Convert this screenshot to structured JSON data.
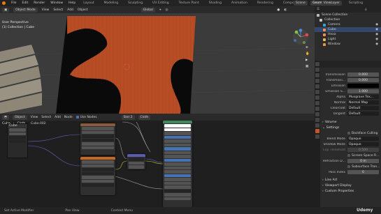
{
  "menubar": {
    "items": [
      "File",
      "Edit",
      "Render",
      "Window",
      "Help"
    ],
    "workspaces": [
      "Layout",
      "Modeling",
      "Sculpting",
      "UV Editing",
      "Texture Paint",
      "Shading",
      "Animation",
      "Rendering",
      "Compositing",
      "Geometry Nodes",
      "Scripting"
    ],
    "active_workspace": "Geometry Nodes",
    "scene": "Scene",
    "view_layer": "ViewLayer"
  },
  "viewport": {
    "mode": "Object Mode",
    "menus": [
      "View",
      "Select",
      "Add",
      "Object"
    ],
    "transform": "Global",
    "perspective_label": "User Perspective",
    "collection_label": "(1) Collection | Cube"
  },
  "outliner": {
    "title": "Scene Collection",
    "rows": [
      {
        "label": "Collection",
        "color": "#c8c8c8",
        "selected": false,
        "indent": 1
      },
      {
        "label": "Camera",
        "color": "#2fa6d8",
        "selected": false,
        "indent": 2
      },
      {
        "label": "Cube",
        "color": "#e8934d",
        "selected": true,
        "indent": 2
      },
      {
        "label": "Hexa",
        "color": "#e8934d",
        "selected": false,
        "indent": 2
      },
      {
        "label": "Light",
        "color": "#e8b84d",
        "selected": false,
        "indent": 2
      },
      {
        "label": "Window",
        "color": "#e8934d",
        "selected": false,
        "indent": 2
      }
    ]
  },
  "properties": {
    "rows": [
      {
        "label": "Transmission",
        "value": "0.000",
        "type": "num"
      },
      {
        "label": "Transmissi...",
        "value": "0.000",
        "type": "num"
      },
      {
        "label": "Emission",
        "value": "",
        "type": "color"
      },
      {
        "label": "Emission S...",
        "value": "1.000",
        "type": "num"
      },
      {
        "label": "Alpha",
        "value": "Musgrave Tex...",
        "type": "link"
      },
      {
        "label": "Normal",
        "value": "Normal Map",
        "type": "link"
      },
      {
        "label": "Clearcoat",
        "value": "Default",
        "type": "link"
      },
      {
        "label": "Tangent",
        "value": "Default",
        "type": "link"
      }
    ],
    "volume_label": "Volume",
    "settings_label": "Settings",
    "backface_label": "Backface Culling",
    "blend_mode_label": "Blend Mode",
    "blend_mode_value": "Opaque",
    "shadow_mode_label": "Shadow Mode",
    "shadow_mode_value": "Opaque",
    "clip_label": "Clip Threshold",
    "clip_value": "0.500",
    "screen_space_label": "Screen Space R...",
    "refraction_label": "Refraction D...",
    "refraction_value": "0 m",
    "subsurface_label": "Subsurface Tran...",
    "pass_index_label": "Pass Index",
    "pass_index_value": "0",
    "line_art_label": "Line Art",
    "viewport_display_label": "Viewport Display",
    "custom_props_label": "Custom Properties"
  },
  "node_editor": {
    "editor_type": "Object",
    "menus": [
      "View",
      "Select",
      "Add",
      "Node"
    ],
    "use_nodes": "Use Nodes",
    "slot": "Slot 2",
    "material": "Cloth",
    "breadcrumb": [
      "Cube",
      "Cloth"
    ],
    "small_panel_title": "Cube",
    "small_panel_item": "Cube.002"
  },
  "statusbar": {
    "items": [
      "Set Active Modifier",
      "Pan View",
      "Context Menu"
    ]
  },
  "watermark": "Udemy",
  "colors": {
    "accent": "#4772b3",
    "fabric": "#c85a2e",
    "selected_row": "#33476b"
  }
}
